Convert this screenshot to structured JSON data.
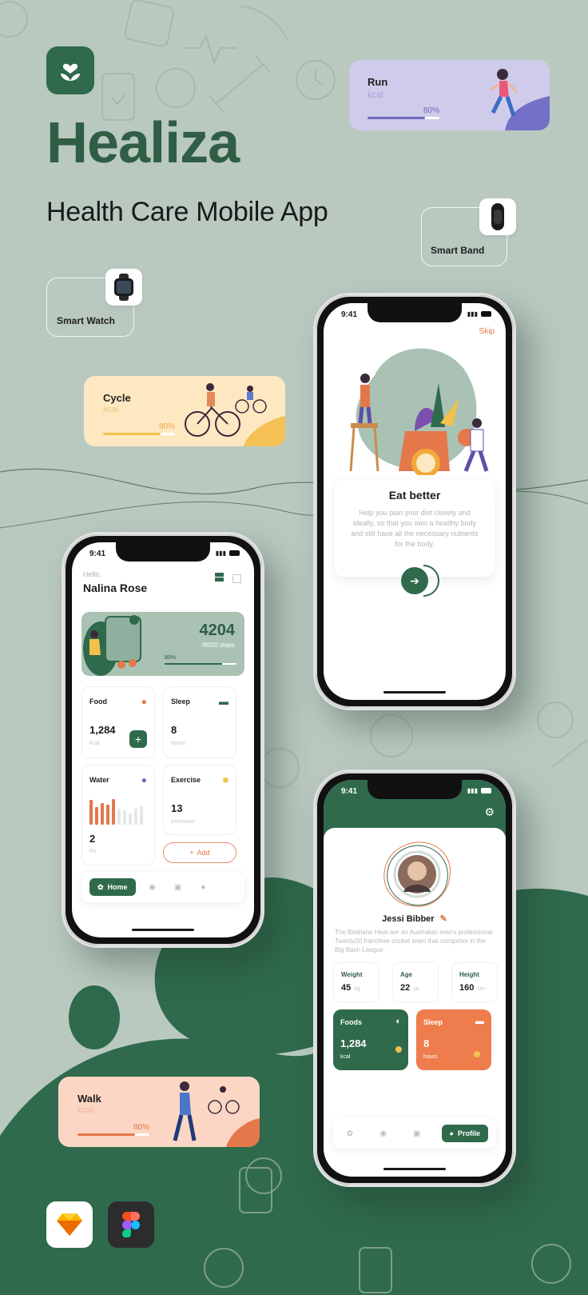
{
  "brand": {
    "name": "Healiza",
    "subtitle": "Health Care Mobile App"
  },
  "colors": {
    "primary": "#2f6a4c",
    "accent": "#e4784a",
    "background": "#b9c9c0"
  },
  "activity_cards": {
    "run": {
      "title": "Run",
      "unit": "kcal",
      "percent": "80%",
      "progress": 0.8
    },
    "cycle": {
      "title": "Cycle",
      "unit": "kcal",
      "percent": "80%",
      "progress": 0.8
    },
    "walk": {
      "title": "Walk",
      "unit": "kcal",
      "percent": "80%",
      "progress": 0.8
    }
  },
  "devices": {
    "smart_band": "Smart Band",
    "smart_watch": "Smart Watch"
  },
  "status_bar": {
    "time": "9:41"
  },
  "onboarding": {
    "skip": "Skip",
    "title": "Eat better",
    "description": "Help you plan your diet closely and ideally, so that you own a healthy body and still have all the necessary nutrients for the body.",
    "next_icon": "arrow-right-icon"
  },
  "home": {
    "greeting": "Hello,",
    "user_name": "Nalina Rose",
    "steps": {
      "value": "4204",
      "goal": "/6000 steps",
      "percent": "80%",
      "progress": 0.8
    },
    "food": {
      "label": "Food",
      "value": "1,284",
      "unit": "kcal"
    },
    "sleep": {
      "label": "Sleep",
      "value": "8",
      "unit": "hours"
    },
    "water": {
      "label": "Water",
      "value": "2",
      "unit": "lits",
      "bars": [
        0.85,
        0.6,
        0.75,
        0.7,
        0.9,
        0.55,
        0.5,
        0.4,
        0.55,
        0.65
      ]
    },
    "exercise": {
      "label": "Exercise",
      "value": "13",
      "unit": "exercises"
    },
    "add_label": "Add",
    "tab_home": "Home"
  },
  "profile": {
    "name": "Jessi Bibber",
    "bio": "The Brisbane Heat are an Australian men's professional Twenty20 franchise cricket team that competes in the Big Bash League.",
    "weight": {
      "label": "Weight",
      "value": "45",
      "unit": "kg"
    },
    "age": {
      "label": "Age",
      "value": "22",
      "unit": "yo"
    },
    "height": {
      "label": "Height",
      "value": "160",
      "unit": "cm"
    },
    "foods": {
      "label": "Foods",
      "value": "1,284",
      "unit": "kcal"
    },
    "sleep": {
      "label": "Sleep",
      "value": "8",
      "unit": "hours"
    },
    "tab_profile": "Profile"
  },
  "tools": [
    "sketch-icon",
    "figma-icon"
  ]
}
